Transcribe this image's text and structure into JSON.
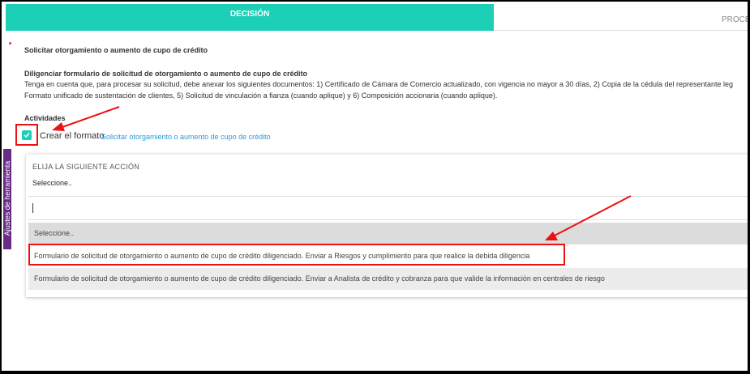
{
  "tabs": {
    "active_label": "DECISIÓN",
    "next_label": "PROCE"
  },
  "side_tab": {
    "label": "Ajustes de herramienta"
  },
  "section": {
    "title": "Solicitar otorgamiento o aumento de cupo de crédito",
    "subtitle": "Diligenciar formulario de solicitud de otorgamiento o aumento de cupo de crédito",
    "desc_line1": "Tenga en cuenta que, para procesar su solicitud, debe anexar los siguientes documentos: 1) Certificado de Cámara de Comercio actualizado, con vigencia no mayor a 30 días, 2) Copia de la cédula del representante leg",
    "desc_line2": "Formato unificado de sustentación de clientes, 5) Solicitud de vinculación a fianza (cuando aplique) y 6) Composición accionaria (cuando aplique).",
    "activities_label": "Actividades"
  },
  "activity": {
    "checked": true,
    "label": "Crear el formato",
    "link": "Solicitar otorgamiento o aumento de cupo de crédito"
  },
  "next_action": {
    "title": "ELIJA LA SIGUIENTE ACCIÓN",
    "selected": "Seleccione..",
    "search_value": "",
    "options": [
      "Seleccione..",
      "Formulario de solicitud de otorgamiento o aumento de cupo de crédito diligenciado. Enviar a Riesgos y cumplimiento para que realice la debida diligencia",
      "Formulario de solicitud de otorgamiento o aumento de cupo de crédito diligenciado. Enviar a Analista de crédito y cobranza para que valide la información en centrales de riesgo"
    ]
  },
  "colors": {
    "accent": "#1ccfb7",
    "link": "#2a9ad5",
    "annotation": "#e11111",
    "side_tab": "#6a2b86"
  }
}
